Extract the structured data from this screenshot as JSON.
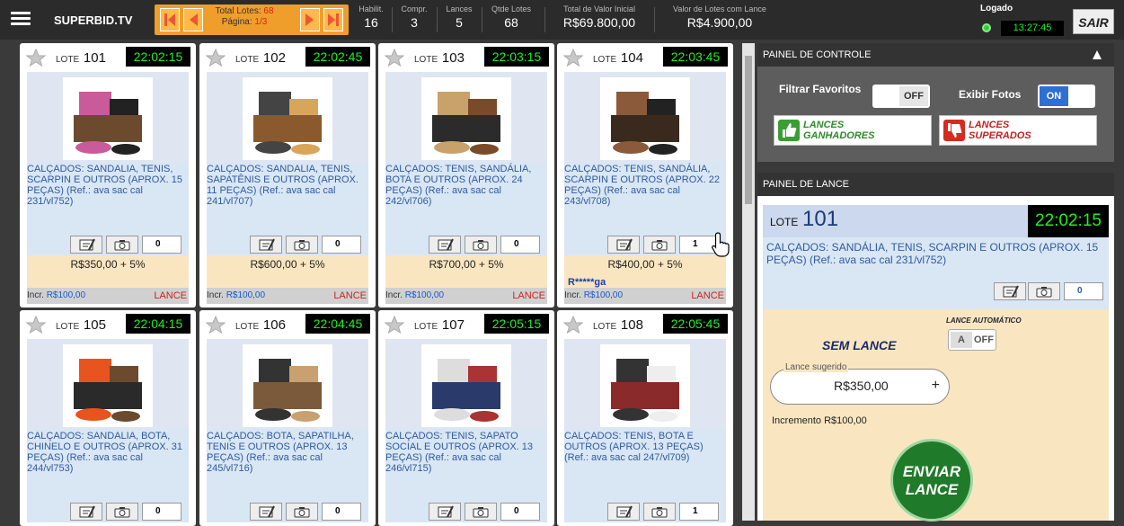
{
  "header": {
    "brand": "SUPERBID.TV",
    "total_lotes_label": "Total Lotes:",
    "total_lotes_value": "68",
    "pagina_label": "Página:",
    "pagina_value": "1/3",
    "stats": [
      {
        "label": "Habilit.",
        "value": "16"
      },
      {
        "label": "Compr.",
        "value": "3"
      },
      {
        "label": "Lances",
        "value": "5"
      },
      {
        "label": "Qtde Lotes",
        "value": "68"
      },
      {
        "label": "Total de Valor Inicial",
        "value": "R$69.800,00"
      },
      {
        "label": "Valor de Lotes com Lance",
        "value": "R$4.900,00"
      }
    ],
    "logado_label": "Logado",
    "clock": "13:27:45",
    "sair_label": "SAIR"
  },
  "lot_label": "LOTE",
  "lots": [
    {
      "number": "101",
      "time": "22:02:15",
      "desc": "CALÇADOS: SANDALIA, TENIS, SCARPIN E OUTROS (APROX. 15 PEÇAS) (Ref.: ava sac cal 231/vl752)",
      "count": "0",
      "price": "R$350,00 + 5%",
      "user": "",
      "incr_label": "Incr.",
      "incr_value": "R$100,00",
      "lance": "LANCE"
    },
    {
      "number": "102",
      "time": "22:02:45",
      "desc": "CALÇADOS: SANDALIA, TENIS, SAPATÊNIS E OUTROS (APROX. 11 PEÇAS) (Ref.: ava sac cal 241/vl707)",
      "count": "0",
      "price": "R$600,00 + 5%",
      "user": "",
      "incr_label": "Incr.",
      "incr_value": "R$100,00",
      "lance": "LANCE"
    },
    {
      "number": "103",
      "time": "22:03:15",
      "desc": "CALÇADOS: TENIS, SANDÁLIA, BOTA E OUTROS (APROX. 24 PEÇAS) (Ref.: ava sac cal 242/vl706)",
      "count": "0",
      "price": "R$700,00 + 5%",
      "user": "",
      "incr_label": "Incr.",
      "incr_value": "R$100,00",
      "lance": "LANCE"
    },
    {
      "number": "104",
      "time": "22:03:45",
      "desc": "CALÇADOS: TENIS, SANDÁLIA, SCARPIN E OUTROS (APROX. 22 PEÇAS) (Ref.: ava sac cal 243/vl708)",
      "count": "1",
      "price": "R$400,00 + 5%",
      "user": "R*****ga",
      "incr_label": "Incr.",
      "incr_value": "R$100,00",
      "lance": "LANCE"
    },
    {
      "number": "105",
      "time": "22:04:15",
      "desc": "CALÇADOS: SANDALIA, BOTA, CHINELO E OUTROS (APROX. 31 PEÇAS) (Ref.: ava sac cal 244/vl753)",
      "count": "0"
    },
    {
      "number": "106",
      "time": "22:04:45",
      "desc": "CALÇADOS: BOTA, SAPATILHA, TENIS E OUTROS (APROX. 13 PEÇAS) (Ref.: ava sac cal 245/vl716)",
      "count": "0"
    },
    {
      "number": "107",
      "time": "22:05:15",
      "desc": "CALÇADOS: TENIS, SAPATO SOCIAL E OUTROS (APROX. 13 PEÇAS) (Ref.: ava sac cal 246/vl715)",
      "count": "0"
    },
    {
      "number": "108",
      "time": "22:05:45",
      "desc": "CALÇADOS: TENIS, BOTA E OUTROS (APROX. 13 PEÇAS) (Ref.: ava sac cal 247/vl709)",
      "count": "1"
    }
  ],
  "control_panel": {
    "title": "PAINEL DE CONTROLE",
    "filtrar_label": "Filtrar Favoritos",
    "filtrar_state": "OFF",
    "exibir_label": "Exibir Fotos",
    "exibir_state": "ON",
    "ganhadores_line1": "LANCES",
    "ganhadores_line2": "GANHADORES",
    "superados_line1": "LANCES",
    "superados_line2": "SUPERADOS"
  },
  "lance_panel": {
    "title": "PAINEL DE LANCE",
    "lote_label": "LOTE",
    "lote_number": "101",
    "time": "22:02:15",
    "desc": "CALÇADOS: SANDÁLIA, TENIS, SCARPIN E OUTROS (APROX. 15 PEÇAS) (Ref.: ava sac cal 231/vl752)",
    "count": "0",
    "status": "SEM LANCE",
    "auto_label": "LANCE AUTOMÁTICO",
    "auto_a": "A",
    "auto_state": "OFF",
    "sugerido_label": "Lance sugerido",
    "sugerido_value": "R$350,00",
    "plus": "+",
    "incremento": "Incremento R$100,00",
    "enviar_line1": "ENVIAR",
    "enviar_line2": "LANCE"
  },
  "colors": {
    "accent": "#ef9e2c",
    "timer_text": "#22ee22",
    "link_blue": "#1a57c9",
    "lance_red": "#cc2222"
  }
}
